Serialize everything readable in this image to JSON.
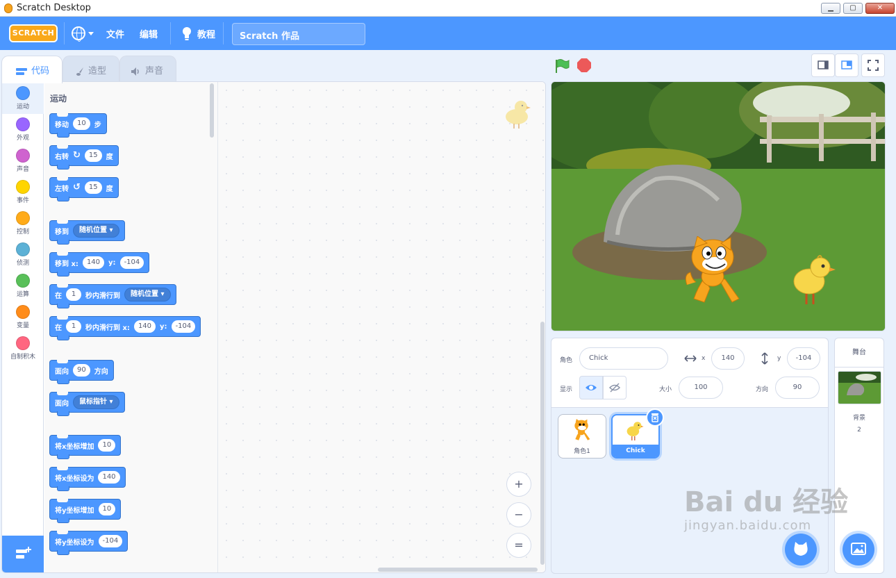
{
  "window": {
    "title": "Scratch Desktop"
  },
  "menubar": {
    "logo": "SCRATCH",
    "file": "文件",
    "edit": "编辑",
    "tutorials": "教程",
    "project_title": "Scratch 作品",
    "accent": "#4c97ff"
  },
  "tabs": [
    {
      "label": "代码",
      "active": true
    },
    {
      "label": "造型",
      "active": false
    },
    {
      "label": "声音",
      "active": false
    }
  ],
  "categories": [
    {
      "label": "运动",
      "color": "#4c97ff"
    },
    {
      "label": "外观",
      "color": "#9966ff"
    },
    {
      "label": "声音",
      "color": "#cf63cf"
    },
    {
      "label": "事件",
      "color": "#ffd500"
    },
    {
      "label": "控制",
      "color": "#ffab19"
    },
    {
      "label": "侦测",
      "color": "#5cb1d6"
    },
    {
      "label": "运算",
      "color": "#59c059"
    },
    {
      "label": "变量",
      "color": "#ff8c1a"
    },
    {
      "label": "自制积木",
      "color": "#ff6680"
    }
  ],
  "palette": {
    "title": "运动",
    "blocks": {
      "move": {
        "a": "移动",
        "n": "10",
        "b": "步"
      },
      "turn_right": {
        "a": "右转",
        "n": "15",
        "b": "度"
      },
      "turn_left": {
        "a": "左转",
        "n": "15",
        "b": "度"
      },
      "goto": {
        "a": "移到",
        "dd": "随机位置"
      },
      "goto_xy": {
        "a": "移到 x:",
        "x": "140",
        "b": "y:",
        "y": "-104"
      },
      "glide_to": {
        "a": "在",
        "n": "1",
        "b": "秒内滑行到",
        "dd": "随机位置"
      },
      "glide_xy": {
        "a": "在",
        "n": "1",
        "b": "秒内滑行到 x:",
        "x": "140",
        "c": "y:",
        "y": "-104"
      },
      "point_dir": {
        "a": "面向",
        "n": "90",
        "b": "方向"
      },
      "point_towards": {
        "a": "面向",
        "dd": "鼠标指针"
      },
      "change_x": {
        "a": "将x坐标增加",
        "n": "10"
      },
      "set_x": {
        "a": "将x坐标设为",
        "n": "140"
      },
      "change_y": {
        "a": "将y坐标增加",
        "n": "10"
      },
      "set_y": {
        "a": "将y坐标设为",
        "n": "-104"
      }
    }
  },
  "zoom": {
    "in": "+",
    "out": "−",
    "reset": "="
  },
  "sprite_info": {
    "sprite_label": "角色",
    "sprite_name": "Chick",
    "x_label": "x",
    "x": "140",
    "y_label": "y",
    "y": "-104",
    "show_label": "显示",
    "size_label": "大小",
    "size": "100",
    "direction_label": "方向",
    "direction": "90"
  },
  "sprites": [
    {
      "name": "角色1",
      "selected": false
    },
    {
      "name": "Chick",
      "selected": true
    }
  ],
  "stage_pane": {
    "title": "舞台",
    "backdrops_label": "背景",
    "backdrops_count": "2"
  },
  "watermark": {
    "big": "Bai du 经验",
    "small": "jingyan.baidu.com"
  }
}
